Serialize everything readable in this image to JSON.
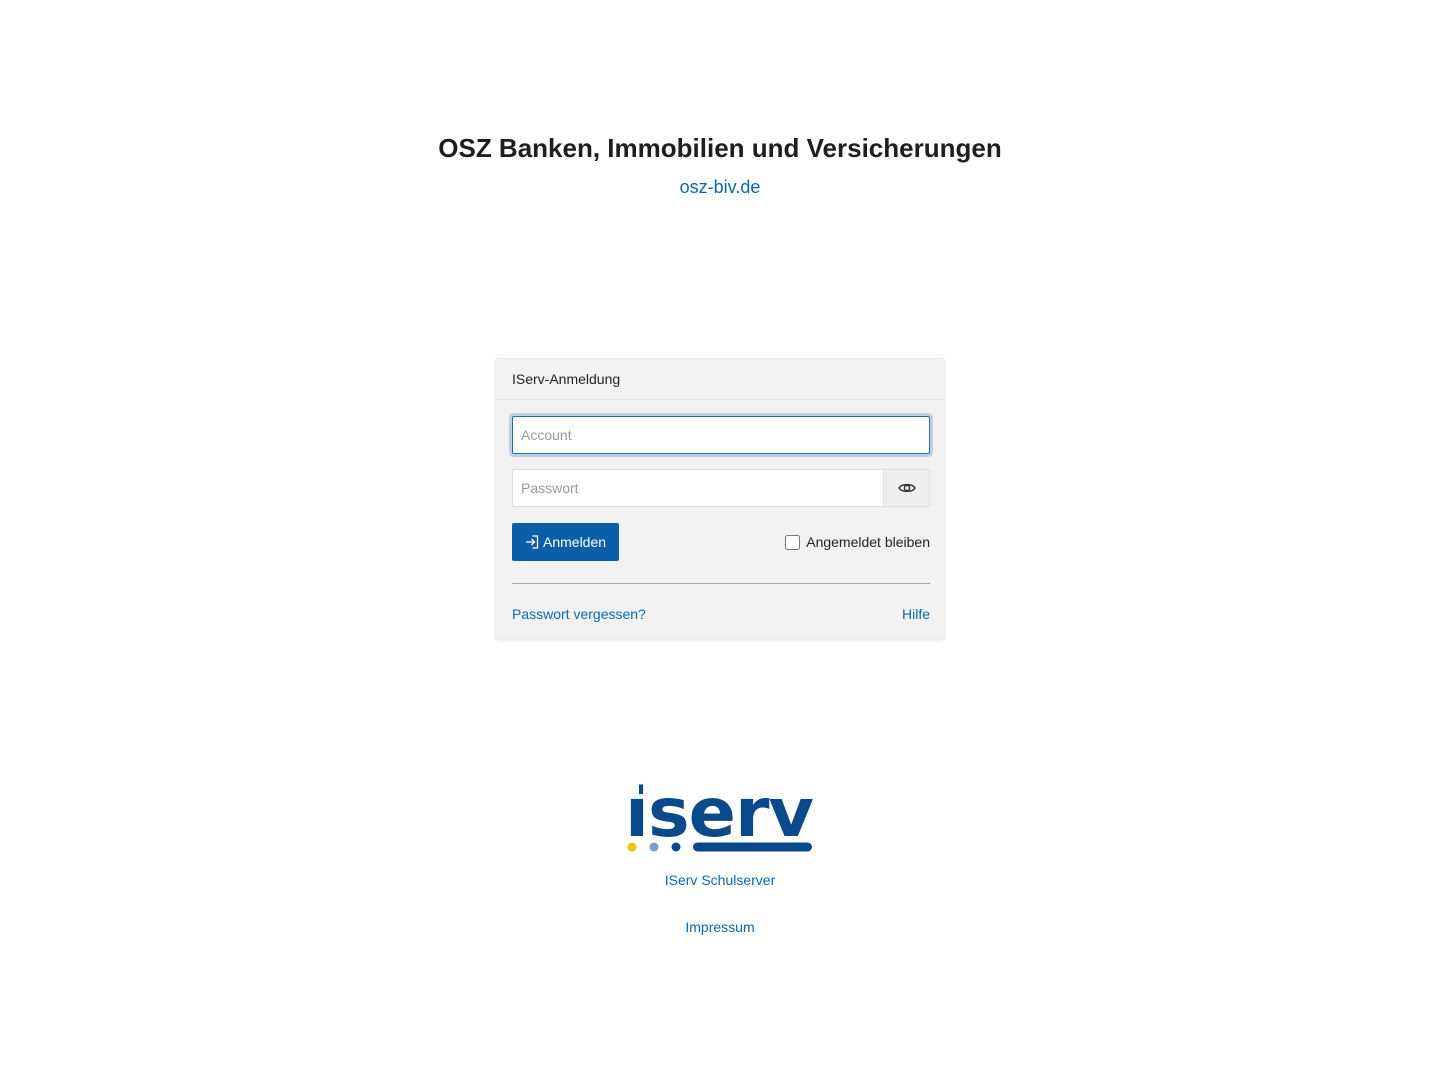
{
  "header": {
    "title": "OSZ Banken, Immobilien und Versicherungen",
    "site_link": "osz-biv.de"
  },
  "login": {
    "card_title": "IServ-Anmeldung",
    "account_placeholder": "Account",
    "password_placeholder": "Passwort",
    "submit_label": "Anmelden",
    "remember_label": "Angemeldet bleiben",
    "remember_checked": false,
    "forgot_link": "Passwort vergessen?",
    "help_link": "Hilfe",
    "icons": {
      "visibility": "eye-icon",
      "submit": "sign-in-icon"
    }
  },
  "footer": {
    "logo_text": "iserv",
    "product_link": "IServ Schulserver",
    "imprint_link": "Impressum"
  },
  "colors": {
    "primary": "#0b5fa9",
    "link": "#0a68b0",
    "logo_dark": "#0a4a8a",
    "logo_dot_yellow": "#f4c20d",
    "logo_dot_light": "#7b9cc8"
  }
}
